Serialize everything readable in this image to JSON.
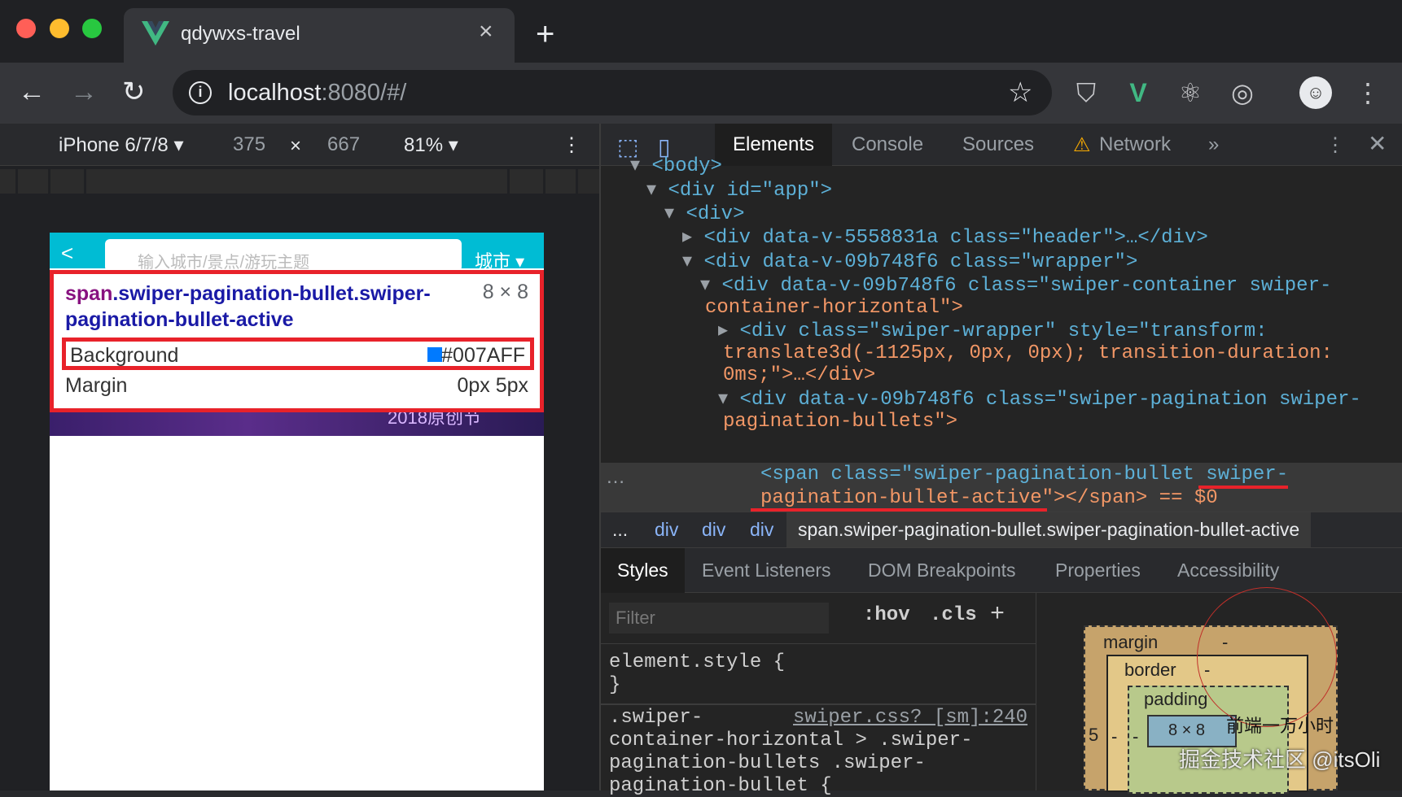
{
  "browser": {
    "tab_title": "qdywxs-travel",
    "tab_close": "×",
    "new_tab": "+",
    "url_host": "localhost",
    "url_rest": ":8080/#/",
    "info_icon": "i"
  },
  "device_toolbar": {
    "device": "iPhone 6/7/8 ▾",
    "width": "375",
    "times": "×",
    "height": "667",
    "zoom": "81% ▾",
    "more": "⋮"
  },
  "phone": {
    "search_placeholder": "输入城市/景点/游玩主题",
    "city_label": "城市 ▾",
    "banner_text": "2018原创节"
  },
  "inspect_tooltip": {
    "tag": "span",
    "selector": ".swiper-pagination-bullet.swiper-pagination-bullet-active",
    "size": "8 × 8",
    "background_label": "Background",
    "background_value": "#007AFF",
    "background_color": "#007aff",
    "margin_label": "Margin",
    "margin_value": "0px 5px"
  },
  "devtools": {
    "tabs": [
      "Elements",
      "Console",
      "Sources",
      "Network"
    ],
    "more_tabs": "»",
    "warning_icon": "warning-icon",
    "dom_lines": [
      "<body>",
      "<div id=\"app\">",
      "<div>",
      "<div data-v-5558831a class=\"header\">…</div>",
      "<div data-v-09b748f6 class=\"wrapper\">",
      "<div data-v-09b748f6 class=\"swiper-container swiper-",
      "container-horizontal\">",
      "<div class=\"swiper-wrapper\" style=\"transform:",
      "translate3d(-1125px, 0px, 0px); transition-duration:",
      "0ms;\">…</div>",
      "<div data-v-09b748f6 class=\"swiper-pagination swiper-",
      "pagination-bullets\">",
      "<span class=\"swiper-pagination-bullet swiper-",
      "pagination-bullet-active\"></span> == $0"
    ],
    "ellipsis": "…",
    "breadcrumb": [
      "...",
      "div",
      "div",
      "div",
      "span.swiper-pagination-bullet.swiper-pagination-bullet-active"
    ],
    "sub_tabs": [
      "Styles",
      "Event Listeners",
      "DOM Breakpoints",
      "Properties",
      "Accessibility"
    ],
    "filter_placeholder": "Filter",
    "hov": ":hov",
    "cls": ".cls",
    "plus": "+",
    "element_style_open": "element.style {",
    "element_style_close": "}",
    "rule_source": "swiper.css? [sm]:240",
    "rule_lines": [
      ".swiper-",
      "container-horizontal > .swiper-",
      "pagination-bullets .swiper-",
      "pagination-bullet {"
    ],
    "box_model": {
      "margin": "margin",
      "border": "border",
      "padding": "padding",
      "margin_left": "5",
      "dash": "-",
      "content": "8 × 8"
    }
  },
  "watermark": {
    "line1": "前端一万小时",
    "line2": "掘金技术社区 @itsOli"
  }
}
